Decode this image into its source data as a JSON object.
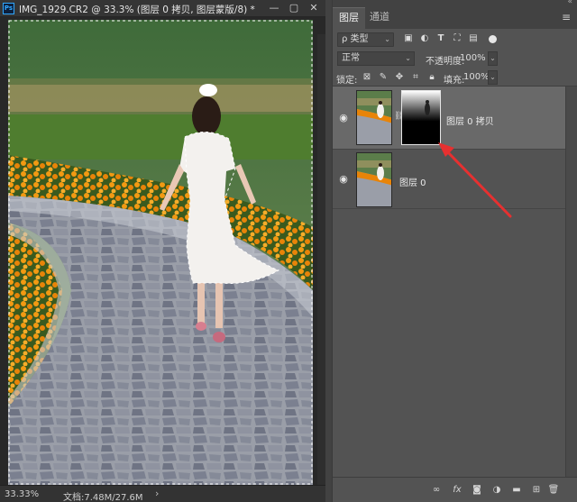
{
  "document": {
    "ps_icon": "Ps",
    "tab_title": "IMG_1929.CR2 @ 33.3% (图层 0 拷贝, 图层蒙版/8) *",
    "controls": {
      "minimize": "—",
      "restore": "▢",
      "close": "✕"
    },
    "status": {
      "zoom": "33.33%",
      "doc_info": "文档:7.48M/27.6M",
      "arrow": "›"
    }
  },
  "panel": {
    "collapse_glyph": "«",
    "menu_glyph": "≡",
    "tabs": [
      {
        "label": "图层",
        "active": true
      },
      {
        "label": "通道",
        "active": false
      }
    ],
    "filter": {
      "kind_label": "ρ 类型",
      "icons": [
        "image-filter-icon",
        "adjustment-filter-icon",
        "type-filter-icon",
        "shape-filter-icon",
        "smartobject-filter-icon"
      ]
    },
    "blend_mode": "正常",
    "opacity_label": "不透明度:",
    "opacity_value": "100%",
    "lock_label": "锁定:",
    "fill_label": "填充:",
    "fill_value": "100%",
    "layers": [
      {
        "name": "图层 0 拷贝",
        "visible": true,
        "selected": true,
        "has_mask": true
      },
      {
        "name": "图层 0",
        "visible": true,
        "selected": false,
        "has_mask": false
      }
    ],
    "bottom_icons": [
      "link-layers-icon",
      "fx-icon",
      "add-mask-icon",
      "adjustment-layer-icon",
      "new-group-icon",
      "new-layer-icon",
      "delete-layer-icon"
    ]
  },
  "annotation": {
    "arrow_color": "#e63030"
  },
  "glyphs": {
    "caret": "⌄",
    "eye": "👁",
    "chain": "⛓",
    "fx": "fx"
  }
}
